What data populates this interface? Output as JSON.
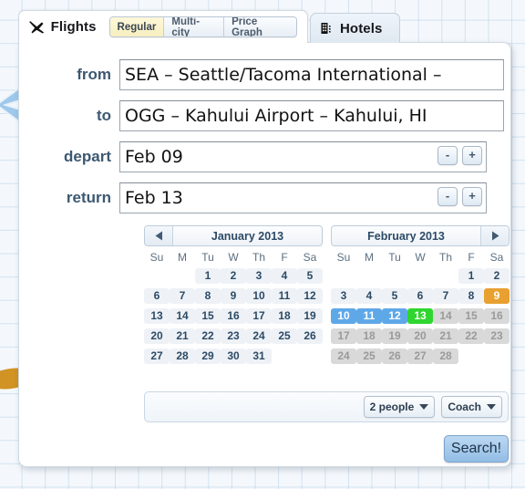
{
  "tabs": {
    "flights": {
      "label": "Flights",
      "icon": "airplane-icon",
      "active": true
    },
    "hotels": {
      "label": "Hotels",
      "icon": "building-icon",
      "active": false
    }
  },
  "segmented": {
    "options": [
      "Regular",
      "Multi-city",
      "Price Graph"
    ],
    "selected": "Regular"
  },
  "form": {
    "from": {
      "label": "from",
      "value": "SEA – Seattle/Tacoma International –"
    },
    "to": {
      "label": "to",
      "value": "OGG – Kahului Airport – Kahului, HI"
    },
    "depart": {
      "label": "depart",
      "value": "Feb 09",
      "minus": "-",
      "plus": "+"
    },
    "return": {
      "label": "return",
      "value": "Feb 13",
      "minus": "-",
      "plus": "+"
    }
  },
  "calendars": [
    {
      "title": "January 2013",
      "nav": "prev",
      "dow": [
        "Su",
        "M",
        "Tu",
        "W",
        "Th",
        "F",
        "Sa"
      ],
      "weeks": [
        [
          {
            "n": "",
            "s": "empty"
          },
          {
            "n": "",
            "s": "empty"
          },
          {
            "n": "1",
            "s": "normal"
          },
          {
            "n": "2",
            "s": "normal"
          },
          {
            "n": "3",
            "s": "normal"
          },
          {
            "n": "4",
            "s": "normal"
          },
          {
            "n": "5",
            "s": "normal"
          }
        ],
        [
          {
            "n": "6",
            "s": "normal"
          },
          {
            "n": "7",
            "s": "normal"
          },
          {
            "n": "8",
            "s": "normal"
          },
          {
            "n": "9",
            "s": "normal"
          },
          {
            "n": "10",
            "s": "normal"
          },
          {
            "n": "11",
            "s": "normal"
          },
          {
            "n": "12",
            "s": "normal"
          }
        ],
        [
          {
            "n": "13",
            "s": "normal"
          },
          {
            "n": "14",
            "s": "normal"
          },
          {
            "n": "15",
            "s": "normal"
          },
          {
            "n": "16",
            "s": "normal"
          },
          {
            "n": "17",
            "s": "normal"
          },
          {
            "n": "18",
            "s": "normal"
          },
          {
            "n": "19",
            "s": "normal"
          }
        ],
        [
          {
            "n": "20",
            "s": "normal"
          },
          {
            "n": "21",
            "s": "normal"
          },
          {
            "n": "22",
            "s": "normal"
          },
          {
            "n": "23",
            "s": "normal"
          },
          {
            "n": "24",
            "s": "normal"
          },
          {
            "n": "25",
            "s": "normal"
          },
          {
            "n": "26",
            "s": "normal"
          }
        ],
        [
          {
            "n": "27",
            "s": "normal"
          },
          {
            "n": "28",
            "s": "normal"
          },
          {
            "n": "29",
            "s": "normal"
          },
          {
            "n": "30",
            "s": "normal"
          },
          {
            "n": "31",
            "s": "normal"
          },
          {
            "n": "",
            "s": "empty"
          },
          {
            "n": "",
            "s": "empty"
          }
        ]
      ]
    },
    {
      "title": "February 2013",
      "nav": "next",
      "dow": [
        "Su",
        "M",
        "Tu",
        "W",
        "Th",
        "F",
        "Sa"
      ],
      "weeks": [
        [
          {
            "n": "",
            "s": "empty"
          },
          {
            "n": "",
            "s": "empty"
          },
          {
            "n": "",
            "s": "empty"
          },
          {
            "n": "",
            "s": "empty"
          },
          {
            "n": "",
            "s": "empty"
          },
          {
            "n": "1",
            "s": "normal"
          },
          {
            "n": "2",
            "s": "normal"
          }
        ],
        [
          {
            "n": "3",
            "s": "normal"
          },
          {
            "n": "4",
            "s": "normal"
          },
          {
            "n": "5",
            "s": "normal"
          },
          {
            "n": "6",
            "s": "normal"
          },
          {
            "n": "7",
            "s": "normal"
          },
          {
            "n": "8",
            "s": "normal"
          },
          {
            "n": "9",
            "s": "depart"
          }
        ],
        [
          {
            "n": "10",
            "s": "range"
          },
          {
            "n": "11",
            "s": "range"
          },
          {
            "n": "12",
            "s": "range"
          },
          {
            "n": "13",
            "s": "ret"
          },
          {
            "n": "14",
            "s": "disabled"
          },
          {
            "n": "15",
            "s": "disabled"
          },
          {
            "n": "16",
            "s": "disabled"
          }
        ],
        [
          {
            "n": "17",
            "s": "disabled"
          },
          {
            "n": "18",
            "s": "disabled"
          },
          {
            "n": "19",
            "s": "disabled"
          },
          {
            "n": "20",
            "s": "disabled"
          },
          {
            "n": "21",
            "s": "disabled"
          },
          {
            "n": "22",
            "s": "disabled"
          },
          {
            "n": "23",
            "s": "disabled"
          }
        ],
        [
          {
            "n": "24",
            "s": "disabled"
          },
          {
            "n": "25",
            "s": "disabled"
          },
          {
            "n": "26",
            "s": "disabled"
          },
          {
            "n": "27",
            "s": "disabled"
          },
          {
            "n": "28",
            "s": "disabled"
          },
          {
            "n": "",
            "s": "empty"
          },
          {
            "n": "",
            "s": "empty"
          }
        ]
      ]
    }
  ],
  "options": {
    "passengers": "2 people",
    "cabin": "Coach"
  },
  "search": {
    "label": "Search!"
  },
  "colors": {
    "depart_day": "#e8a130",
    "range_day": "#5fa8e8",
    "return_day": "#2fd62f",
    "disabled_day": "#d9d9d9",
    "accent_button": "#92bde6",
    "label_text": "#3d5871"
  }
}
